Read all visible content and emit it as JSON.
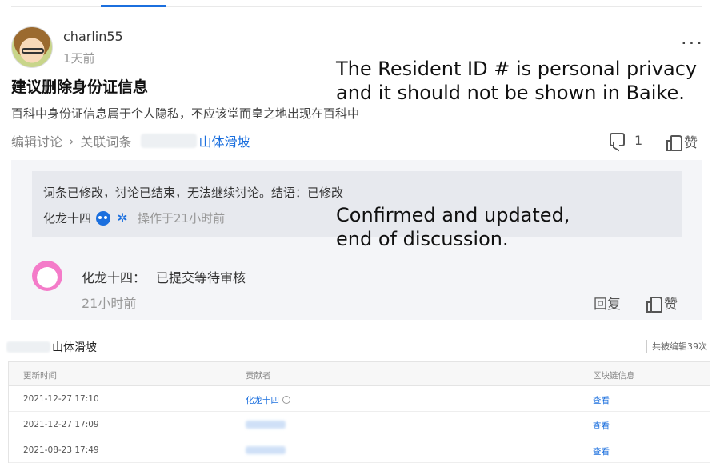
{
  "post": {
    "username": "charlin55",
    "time": "1天前",
    "title": "建议删除身份证信息",
    "description": "百科中身份证信息属于个人隐私，不应该堂而皇之地出现在百科中",
    "actions": {
      "edit_discussion": "编辑讨论",
      "related_entry": "关联词条",
      "entry_name": "山体滑坡",
      "comment_count": "1",
      "like_label": "赞"
    }
  },
  "annotations": {
    "note1_line1": "The Resident ID # is personal privacy",
    "note1_line2": "and it should not be shown in Baike.",
    "note2_line1": "Confirmed and updated,",
    "note2_line2": "end of discussion."
  },
  "closed_notice": {
    "text": "词条已修改，讨论已结束，无法继续讨论。结语：已修改",
    "user": "化龙十四",
    "operated": "操作于21小时前"
  },
  "reply": {
    "user": "化龙十四：",
    "text": "已提交等待审核",
    "time": "21小时前",
    "reply_label": "回复",
    "like_label": "赞"
  },
  "history": {
    "entry_name": "山体滑坡",
    "edit_count": "共被编辑39次",
    "columns": [
      "更新时间",
      "贡献者",
      "区块链信息"
    ],
    "rows": [
      {
        "time": "2021-12-27 17:10",
        "contributor": "化龙十四",
        "chain": "查看"
      },
      {
        "time": "2021-12-27 17:09",
        "contributor": "",
        "chain": "查看"
      },
      {
        "time": "2021-08-23 17:49",
        "contributor": "",
        "chain": "查看"
      }
    ]
  },
  "colors": {
    "accent": "#1b6fde",
    "panel_bg": "#f4f5f8",
    "notice_bg": "#e7e9ee"
  }
}
